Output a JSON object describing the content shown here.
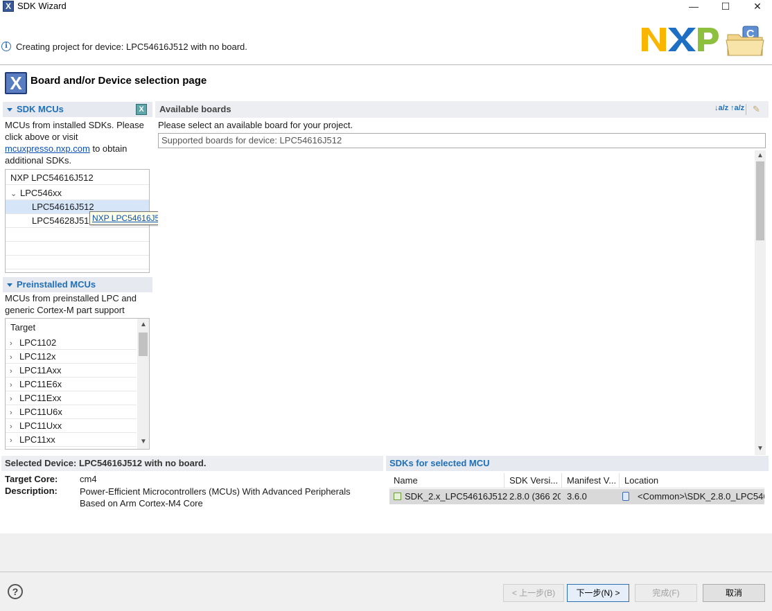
{
  "window": {
    "title": "SDK Wizard",
    "icon": "x-app-icon",
    "minimize": "—",
    "maximize": "☐",
    "close": "✕"
  },
  "message": {
    "text": "Creating project for device: LPC54616J512 with no board."
  },
  "logo": {
    "brand": "NXP"
  },
  "page": {
    "title": "Board and/or Device selection page"
  },
  "sdk_mcus": {
    "header": "SDK MCUs",
    "desc_1": "MCUs from installed SDKs. Please",
    "desc_2": "click above or visit",
    "link": "mcuxpresso.nxp.com",
    "desc_3": "to obtain",
    "desc_4": "additional SDKs.",
    "tree": [
      {
        "label": "NXP LPC54616J512",
        "level": 0,
        "expander": ""
      },
      {
        "label": "LPC546xx",
        "level": 0,
        "expander": "v"
      },
      {
        "label": "LPC54616J512",
        "level": 2,
        "expander": "",
        "selected": true
      },
      {
        "label": "LPC54628J512",
        "level": 2,
        "expander": ""
      }
    ],
    "tooltip": "NXP LPC54616J512"
  },
  "preinstalled": {
    "header": "Preinstalled MCUs",
    "desc_1": "MCUs from preinstalled LPC and",
    "desc_2": "generic Cortex-M part support",
    "column": "Target",
    "items": [
      "LPC1102",
      "LPC112x",
      "LPC11Axx",
      "LPC11E6x",
      "LPC11Exx",
      "LPC11U6x",
      "LPC11Uxx",
      "LPC11xx"
    ]
  },
  "boards": {
    "header": "Available boards",
    "instruction": "Please select an available board for your project.",
    "filter_value": "Supported boards for device: LPC54616J512",
    "sort_az": "↓a/z",
    "sort_za": "↑a/z"
  },
  "selected_device": {
    "header": "Selected Device: LPC54616J512 with no board.",
    "core_label": "Target Core:",
    "core_value": "cm4",
    "desc_label": "Description:",
    "desc_value_1": "Power-Efficient Microcontrollers (MCUs) With Advanced Peripherals",
    "desc_value_2": "Based on Arm Cortex-M4 Core"
  },
  "sdks": {
    "header": "SDKs for selected MCU",
    "columns": [
      "Name",
      "SDK Versi...",
      "Manifest V...",
      "Location"
    ],
    "rows": [
      {
        "name": "SDK_2.x_LPC54616J512",
        "version": "2.8.0 (366 20",
        "manifest": "3.6.0",
        "location": "<Common>\\SDK_2.8.0_LPC546"
      }
    ]
  },
  "footer": {
    "help": "?",
    "back": "< 上一步(B)",
    "next": "下一步(N) >",
    "finish": "完成(F)",
    "cancel": "取消"
  },
  "colors": {
    "accent": "#1f6fb8",
    "selection": "#d6e6f8",
    "nxp_yellow": "#f9b500",
    "nxp_blue": "#1c6fc3",
    "nxp_green": "#8ec03f"
  }
}
